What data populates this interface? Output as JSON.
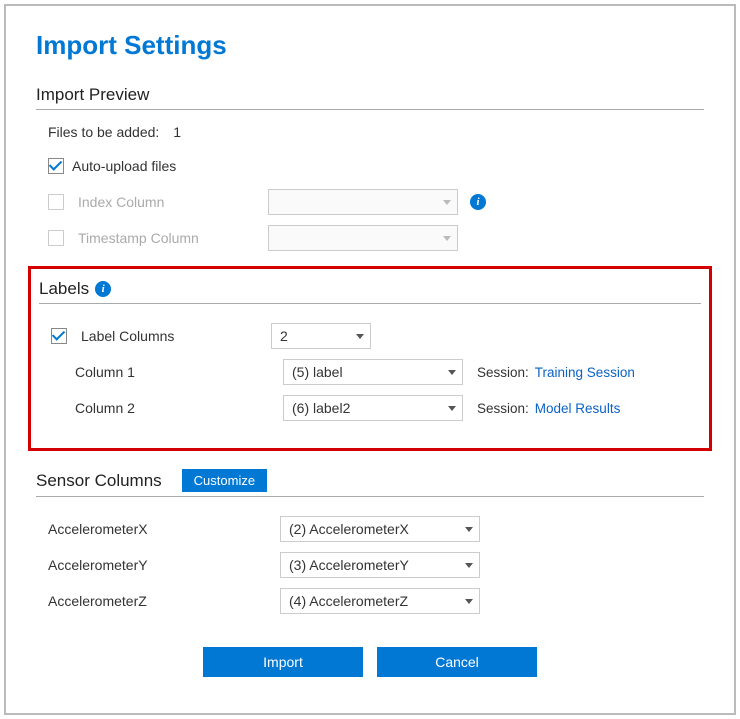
{
  "title": "Import Settings",
  "preview": {
    "heading": "Import Preview",
    "filesLabel": "Files to be added:",
    "filesCount": "1",
    "autoUploadLabel": "Auto-upload files",
    "indexColumnLabel": "Index Column",
    "indexColumnValue": "",
    "timestampColumnLabel": "Timestamp Column",
    "timestampColumnValue": ""
  },
  "labels": {
    "heading": "Labels",
    "labelColumnsLabel": "Label Columns",
    "labelColumnsValue": "2",
    "columns": [
      {
        "label": "Column 1",
        "value": "(5) label",
        "sessionLabel": "Session:",
        "sessionLink": "Training Session"
      },
      {
        "label": "Column 2",
        "value": "(6) label2",
        "sessionLabel": "Session:",
        "sessionLink": "Model Results"
      }
    ]
  },
  "sensors": {
    "heading": "Sensor Columns",
    "customizeLabel": "Customize",
    "rows": [
      {
        "label": "AccelerometerX",
        "value": "(2) AccelerometerX"
      },
      {
        "label": "AccelerometerY",
        "value": "(3) AccelerometerY"
      },
      {
        "label": "AccelerometerZ",
        "value": "(4) AccelerometerZ"
      }
    ]
  },
  "buttons": {
    "import": "Import",
    "cancel": "Cancel"
  },
  "infoGlyph": "i"
}
